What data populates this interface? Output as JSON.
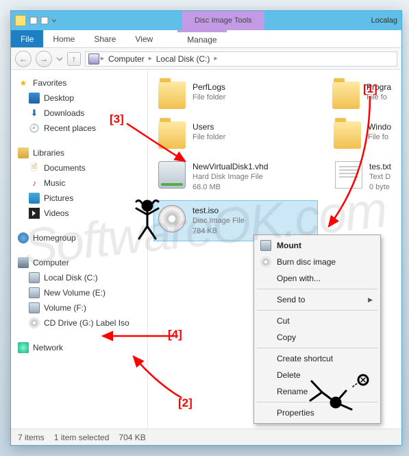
{
  "titlebar": {
    "contextual": "Disc Image Tools",
    "title_hint": "Localag"
  },
  "ribbon": {
    "file": "File",
    "home": "Home",
    "share": "Share",
    "view": "View",
    "manage": "Manage"
  },
  "breadcrumb": {
    "root": "Computer",
    "disk": "Local Disk (C:)"
  },
  "nav": {
    "favorites": {
      "label": "Favorites",
      "items": [
        {
          "label": "Desktop",
          "ico": "desk"
        },
        {
          "label": "Downloads",
          "ico": "dl"
        },
        {
          "label": "Recent places",
          "ico": "recent"
        }
      ]
    },
    "libraries": {
      "label": "Libraries",
      "items": [
        {
          "label": "Documents",
          "ico": "doc"
        },
        {
          "label": "Music",
          "ico": "music"
        },
        {
          "label": "Pictures",
          "ico": "pic"
        },
        {
          "label": "Videos",
          "ico": "vid"
        }
      ]
    },
    "homegroup": {
      "label": "Homegroup"
    },
    "computer": {
      "label": "Computer",
      "items": [
        {
          "label": "Local Disk (C:)",
          "ico": "hdd"
        },
        {
          "label": "New Volume (E:)",
          "ico": "hdd"
        },
        {
          "label": "Volume (F:)",
          "ico": "hdd"
        },
        {
          "label": "CD Drive (G:) Label Iso",
          "ico": "cd"
        }
      ]
    },
    "network": {
      "label": "Network"
    }
  },
  "files": {
    "perflogs": {
      "name": "PerfLogs",
      "sub1": "File folder"
    },
    "program": {
      "name": "Progra",
      "sub1": "File fo"
    },
    "users": {
      "name": "Users",
      "sub1": "File folder"
    },
    "windows": {
      "name": "Windo",
      "sub1": "File fo"
    },
    "vhd": {
      "name": "NewVirtualDisk1.vhd",
      "sub1": "Hard Disk Image File",
      "sub2": "68.0 MB"
    },
    "testtxt": {
      "name": "tes.txt",
      "sub1": "Text D",
      "sub2": "0 byte"
    },
    "iso": {
      "name": "test.iso",
      "sub1": "Disc Image File",
      "sub2": "784 KB"
    }
  },
  "context_menu": {
    "mount": "Mount",
    "burn": "Burn disc image",
    "openwith": "Open with...",
    "sendto": "Send to",
    "cut": "Cut",
    "copy": "Copy",
    "shortcut": "Create shortcut",
    "delete": "Delete",
    "rename": "Rename",
    "properties": "Properties"
  },
  "status": {
    "count": "7 items",
    "selection": "1 item selected",
    "size": "704 KB"
  },
  "annotations": {
    "a1": "[1]",
    "a2": "[2]",
    "a3": "[3]",
    "a4": "[4]"
  },
  "watermark": "SoftwareOK.com"
}
